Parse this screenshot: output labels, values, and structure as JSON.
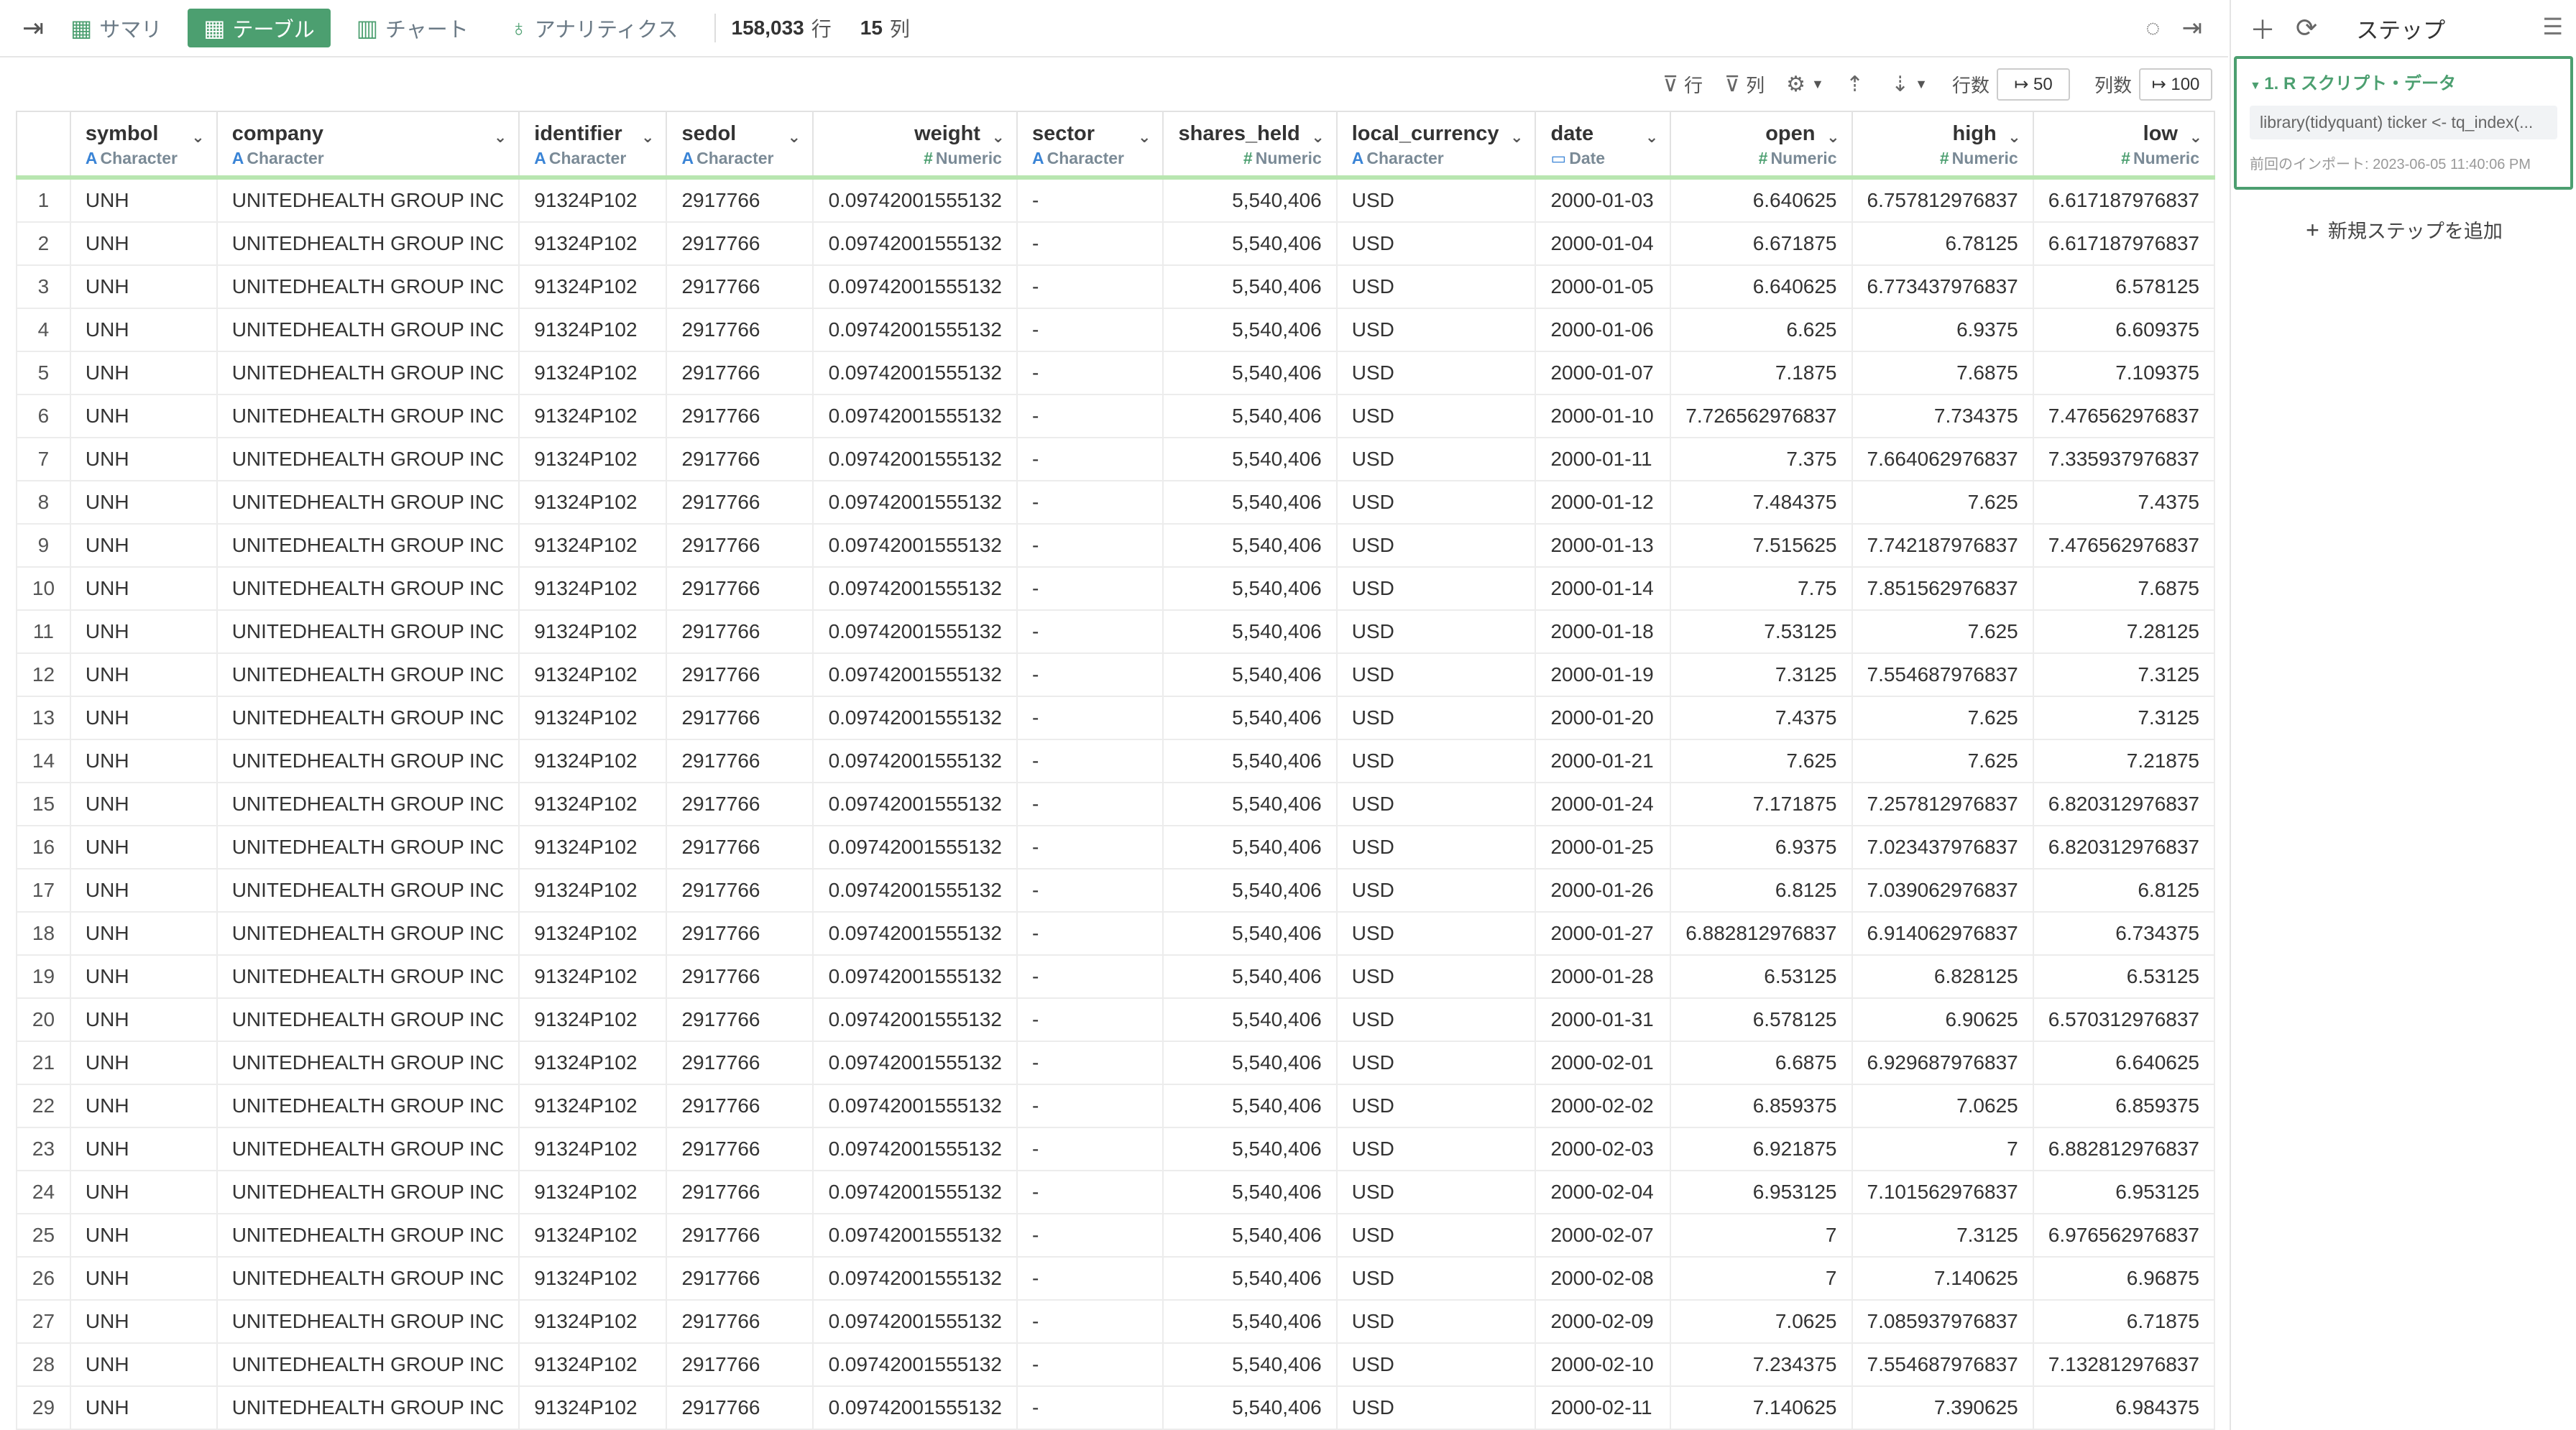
{
  "toolbar": {
    "tabs": [
      {
        "label": "サマリ",
        "icon": "summary-grid-icon"
      },
      {
        "label": "テーブル",
        "icon": "table-icon"
      },
      {
        "label": "チャート",
        "icon": "bar-chart-icon"
      },
      {
        "label": "アナリティクス",
        "icon": "lightbulb-icon"
      }
    ],
    "row_count": "158,033",
    "row_unit": "行",
    "col_count": "15",
    "col_unit": "列"
  },
  "subbar": {
    "row_filter": "行",
    "col_filter": "列",
    "rows_label": "行数",
    "rows_value": "↦ 50",
    "cols_label": "列数",
    "cols_value": "↦ 100"
  },
  "columns": [
    {
      "name": "symbol",
      "type": "Character",
      "align": "left"
    },
    {
      "name": "company",
      "type": "Character",
      "align": "left"
    },
    {
      "name": "identifier",
      "type": "Character",
      "align": "left"
    },
    {
      "name": "sedol",
      "type": "Character",
      "align": "left"
    },
    {
      "name": "weight",
      "type": "Numeric",
      "align": "right"
    },
    {
      "name": "sector",
      "type": "Character",
      "align": "left"
    },
    {
      "name": "shares_held",
      "type": "Numeric",
      "align": "right"
    },
    {
      "name": "local_currency",
      "type": "Character",
      "align": "left"
    },
    {
      "name": "date",
      "type": "Date",
      "align": "left"
    },
    {
      "name": "open",
      "type": "Numeric",
      "align": "right"
    },
    {
      "name": "high",
      "type": "Numeric",
      "align": "right"
    },
    {
      "name": "low",
      "type": "Numeric",
      "align": "right"
    }
  ],
  "common": {
    "symbol": "UNH",
    "company": "UNITEDHEALTH GROUP INC",
    "identifier": "91324P102",
    "sedol": "2917766",
    "weight": "0.09742001555132",
    "sector": "-",
    "shares_held": "5,540,406",
    "local_currency": "USD"
  },
  "rows": [
    {
      "n": "1",
      "date": "2000-01-03",
      "open": "6.640625",
      "high": "6.757812976837",
      "low": "6.617187976837"
    },
    {
      "n": "2",
      "date": "2000-01-04",
      "open": "6.671875",
      "high": "6.78125",
      "low": "6.617187976837"
    },
    {
      "n": "3",
      "date": "2000-01-05",
      "open": "6.640625",
      "high": "6.773437976837",
      "low": "6.578125"
    },
    {
      "n": "4",
      "date": "2000-01-06",
      "open": "6.625",
      "high": "6.9375",
      "low": "6.609375"
    },
    {
      "n": "5",
      "date": "2000-01-07",
      "open": "7.1875",
      "high": "7.6875",
      "low": "7.109375"
    },
    {
      "n": "6",
      "date": "2000-01-10",
      "open": "7.726562976837",
      "high": "7.734375",
      "low": "7.476562976837"
    },
    {
      "n": "7",
      "date": "2000-01-11",
      "open": "7.375",
      "high": "7.664062976837",
      "low": "7.335937976837"
    },
    {
      "n": "8",
      "date": "2000-01-12",
      "open": "7.484375",
      "high": "7.625",
      "low": "7.4375"
    },
    {
      "n": "9",
      "date": "2000-01-13",
      "open": "7.515625",
      "high": "7.742187976837",
      "low": "7.476562976837"
    },
    {
      "n": "10",
      "date": "2000-01-14",
      "open": "7.75",
      "high": "7.851562976837",
      "low": "7.6875"
    },
    {
      "n": "11",
      "date": "2000-01-18",
      "open": "7.53125",
      "high": "7.625",
      "low": "7.28125"
    },
    {
      "n": "12",
      "date": "2000-01-19",
      "open": "7.3125",
      "high": "7.554687976837",
      "low": "7.3125"
    },
    {
      "n": "13",
      "date": "2000-01-20",
      "open": "7.4375",
      "high": "7.625",
      "low": "7.3125"
    },
    {
      "n": "14",
      "date": "2000-01-21",
      "open": "7.625",
      "high": "7.625",
      "low": "7.21875"
    },
    {
      "n": "15",
      "date": "2000-01-24",
      "open": "7.171875",
      "high": "7.257812976837",
      "low": "6.820312976837"
    },
    {
      "n": "16",
      "date": "2000-01-25",
      "open": "6.9375",
      "high": "7.023437976837",
      "low": "6.820312976837"
    },
    {
      "n": "17",
      "date": "2000-01-26",
      "open": "6.8125",
      "high": "7.039062976837",
      "low": "6.8125"
    },
    {
      "n": "18",
      "date": "2000-01-27",
      "open": "6.882812976837",
      "high": "6.914062976837",
      "low": "6.734375"
    },
    {
      "n": "19",
      "date": "2000-01-28",
      "open": "6.53125",
      "high": "6.828125",
      "low": "6.53125"
    },
    {
      "n": "20",
      "date": "2000-01-31",
      "open": "6.578125",
      "high": "6.90625",
      "low": "6.570312976837"
    },
    {
      "n": "21",
      "date": "2000-02-01",
      "open": "6.6875",
      "high": "6.929687976837",
      "low": "6.640625"
    },
    {
      "n": "22",
      "date": "2000-02-02",
      "open": "6.859375",
      "high": "7.0625",
      "low": "6.859375"
    },
    {
      "n": "23",
      "date": "2000-02-03",
      "open": "6.921875",
      "high": "7",
      "low": "6.882812976837"
    },
    {
      "n": "24",
      "date": "2000-02-04",
      "open": "6.953125",
      "high": "7.101562976837",
      "low": "6.953125"
    },
    {
      "n": "25",
      "date": "2000-02-07",
      "open": "7",
      "high": "7.3125",
      "low": "6.976562976837"
    },
    {
      "n": "26",
      "date": "2000-02-08",
      "open": "7",
      "high": "7.140625",
      "low": "6.96875"
    },
    {
      "n": "27",
      "date": "2000-02-09",
      "open": "7.0625",
      "high": "7.085937976837",
      "low": "6.71875"
    },
    {
      "n": "28",
      "date": "2000-02-10",
      "open": "7.234375",
      "high": "7.554687976837",
      "low": "7.132812976837"
    },
    {
      "n": "29",
      "date": "2000-02-11",
      "open": "7.140625",
      "high": "7.390625",
      "low": "6.984375"
    }
  ],
  "panel": {
    "title": "ステップ",
    "step": {
      "title": "1. R スクリプト・データ",
      "code": "library(tidyquant) ticker <- tq_index(...",
      "meta": "前回のインポート: 2023-06-05 11:40:06 PM"
    },
    "add_step": "新規ステップを追加"
  },
  "colors": {
    "accent": "#4c9f70",
    "header_underline": "#b8e6b0",
    "type_char": "#3a84d6"
  }
}
